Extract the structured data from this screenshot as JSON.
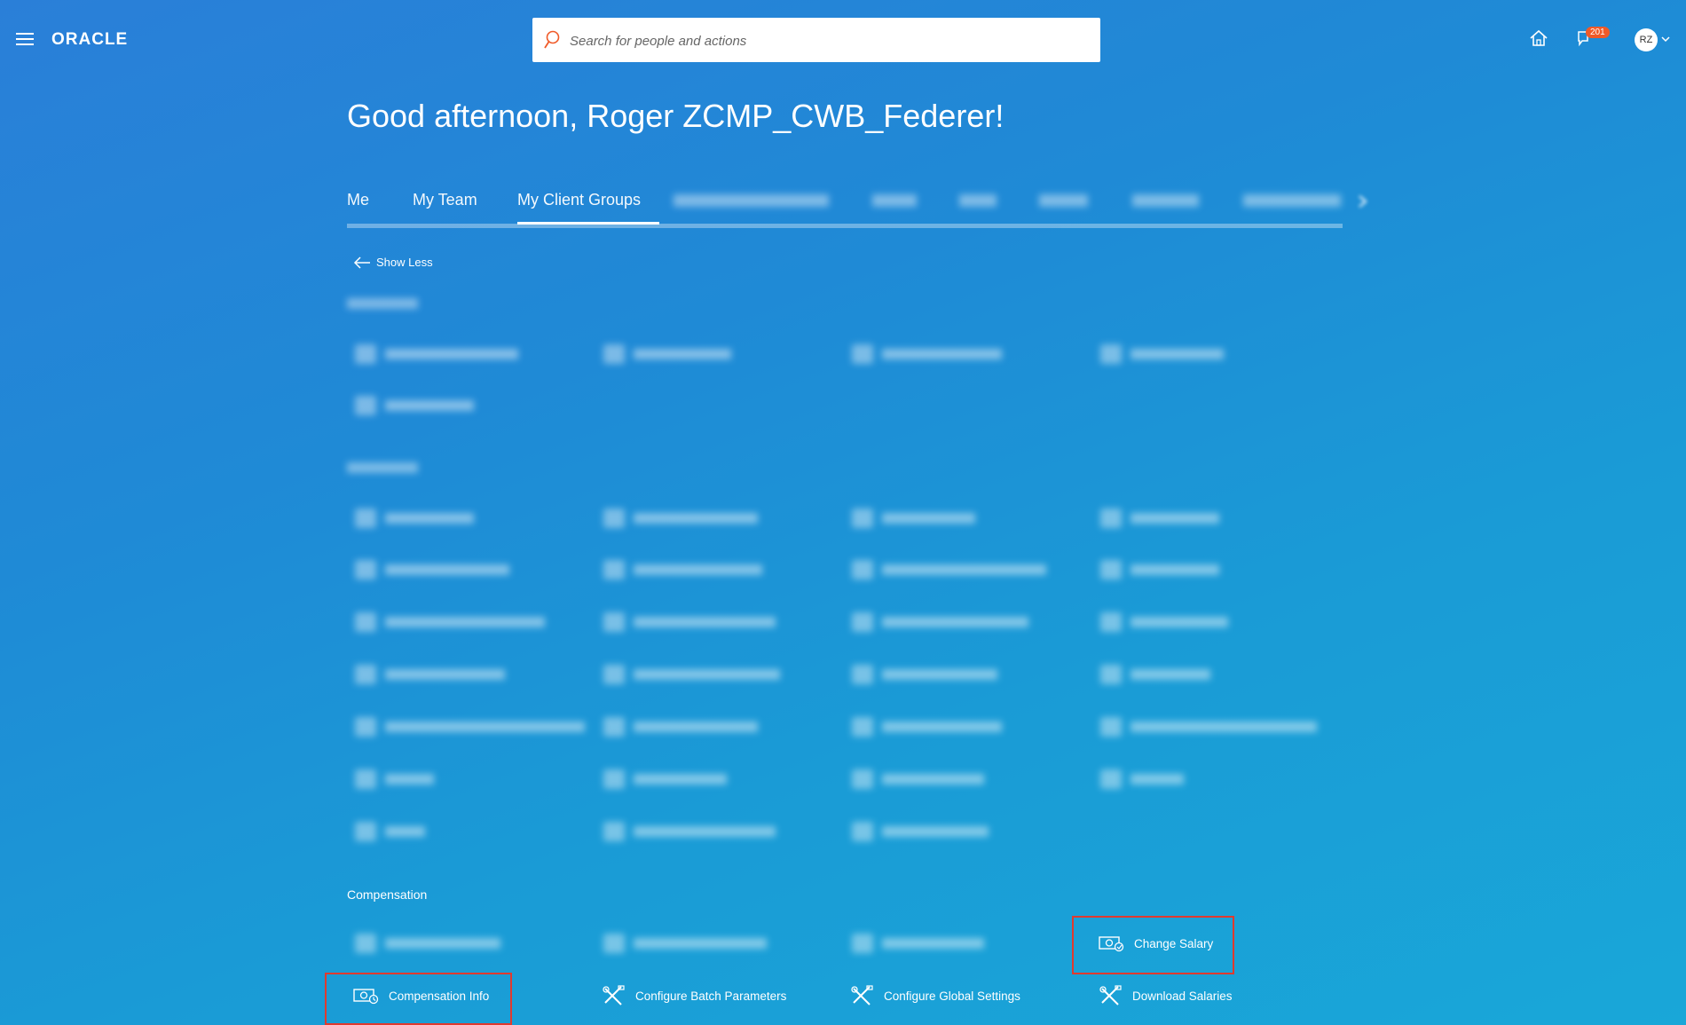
{
  "header": {
    "logo": "ORACLE",
    "search_placeholder": "Search for people and actions",
    "notification_count": "201",
    "avatar_initials": "RZ"
  },
  "greeting": "Good afternoon, Roger ZCMP_CWB_Federer!",
  "tabs": {
    "me": "Me",
    "my_team": "My Team",
    "my_client_groups": "My Client Groups"
  },
  "show_less": "Show Less",
  "compensation": {
    "title": "Compensation",
    "change_salary": "Change Salary",
    "compensation_info": "Compensation Info",
    "configure_batch_parameters": "Configure Batch Parameters",
    "configure_global_settings": "Configure Global Settings",
    "download_salaries": "Download Salaries"
  },
  "colors": {
    "highlight_box": "#e03a2f",
    "notification_badge": "#f05a28"
  }
}
